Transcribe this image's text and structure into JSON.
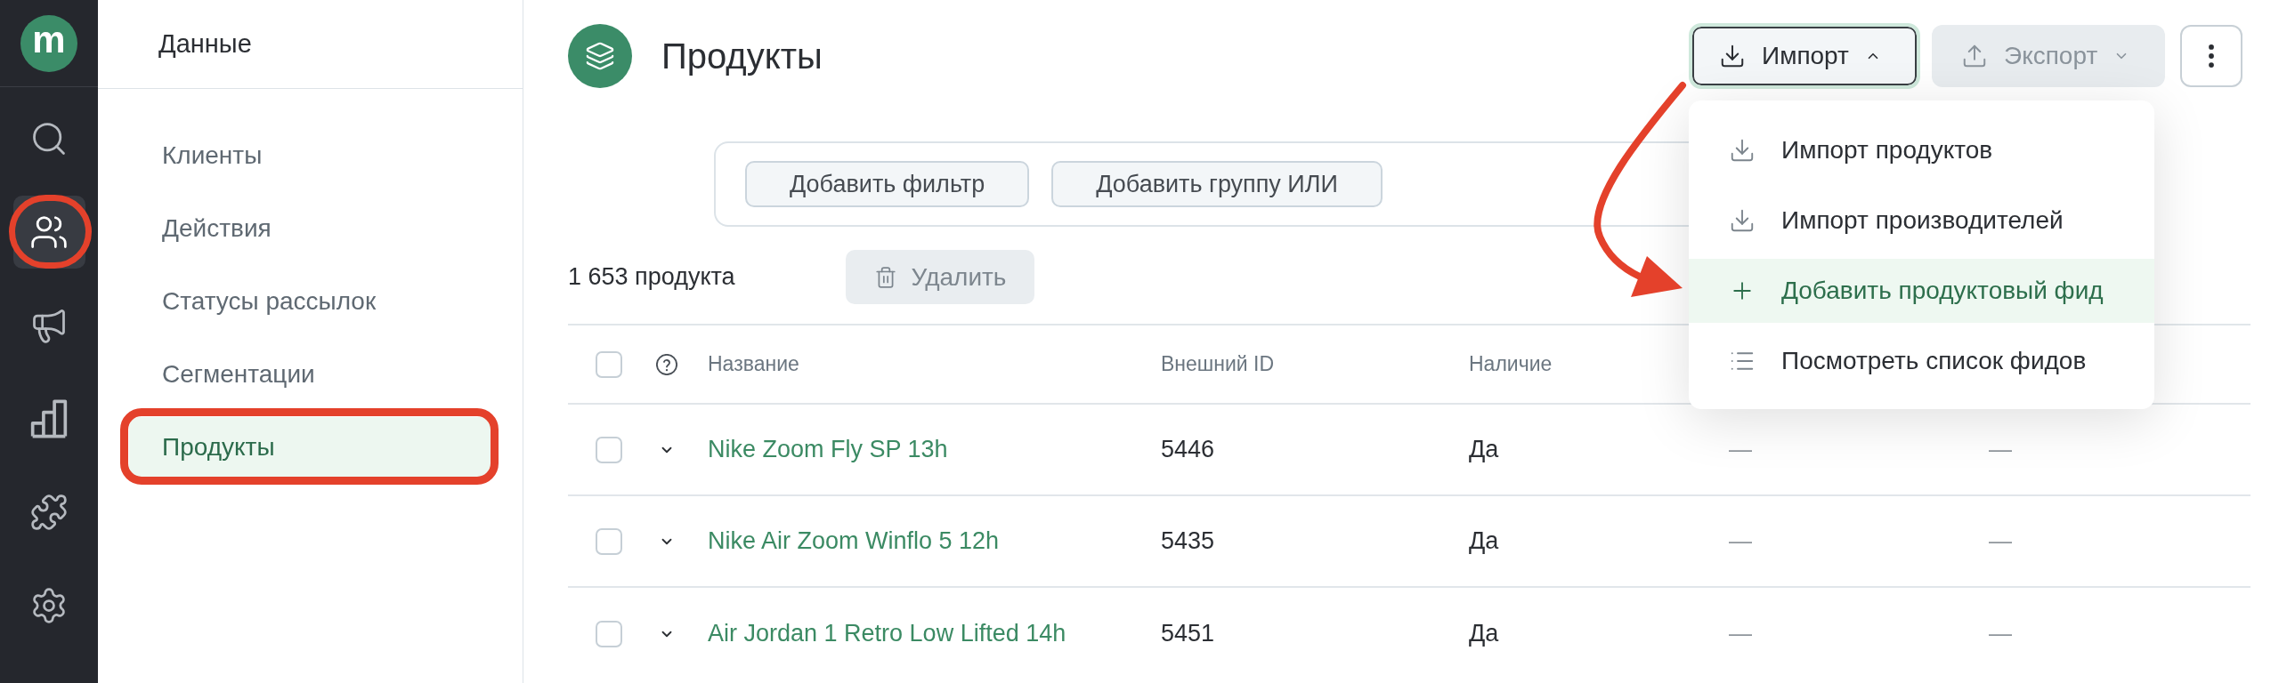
{
  "rail": {
    "logo": {
      "text": "m"
    },
    "items": [
      {
        "selected": false,
        "annotated": false
      },
      {
        "selected": true,
        "annotated": true
      },
      {
        "selected": false,
        "annotated": false
      },
      {
        "selected": false,
        "annotated": false
      },
      {
        "selected": false,
        "annotated": false
      },
      {
        "selected": false,
        "annotated": false
      }
    ]
  },
  "sidebar": {
    "title": "Данные",
    "items": [
      {
        "label": "Клиенты",
        "selected": false,
        "annotated": false
      },
      {
        "label": "Действия",
        "selected": false,
        "annotated": false
      },
      {
        "label": "Статусы рассылок",
        "selected": false,
        "annotated": false
      },
      {
        "label": "Сегментации",
        "selected": false,
        "annotated": false
      },
      {
        "label": "Продукты",
        "selected": true,
        "annotated": true
      }
    ]
  },
  "page": {
    "title": "Продукты"
  },
  "toolbar": {
    "import": {
      "label": "Импорт",
      "expanded": true,
      "menu": {
        "items": [
          {
            "label": "Импорт продуктов",
            "selected": false,
            "annotated": false
          },
          {
            "label": "Импорт производителей",
            "selected": false,
            "annotated": false
          },
          {
            "label": "Добавить продуктовый фид",
            "selected": true,
            "annotated": true
          },
          {
            "label": "Посмотреть список фидов",
            "selected": false,
            "annotated": false
          }
        ]
      }
    },
    "export": {
      "label": "Экспорт",
      "disabled": true
    }
  },
  "filters": {
    "buttons": [
      "Добавить фильтр",
      "Добавить группу ИЛИ"
    ]
  },
  "summary": {
    "count": "1 653 продукта",
    "delete": {
      "label": "Удалить",
      "disabled": true
    }
  },
  "table": {
    "select_all": {
      "checked": false
    },
    "columns": [
      "Название",
      "Внешний ID",
      "Наличие"
    ],
    "rows": [
      {
        "checked": false,
        "expanded": false,
        "name": "Nike Zoom Fly SP 13h",
        "external_id": "5446",
        "availability": "Да",
        "column_4": "—",
        "column_5": "—"
      },
      {
        "checked": false,
        "expanded": false,
        "name": "Nike Air Zoom Winflo 5 12h",
        "external_id": "5435",
        "availability": "Да",
        "column_4": "—",
        "column_5": "—"
      },
      {
        "checked": false,
        "expanded": false,
        "name": "Air Jordan 1 Retro Low Lifted 14h",
        "external_id": "5451",
        "availability": "Да",
        "column_4": "—",
        "column_5": "—"
      }
    ]
  }
}
